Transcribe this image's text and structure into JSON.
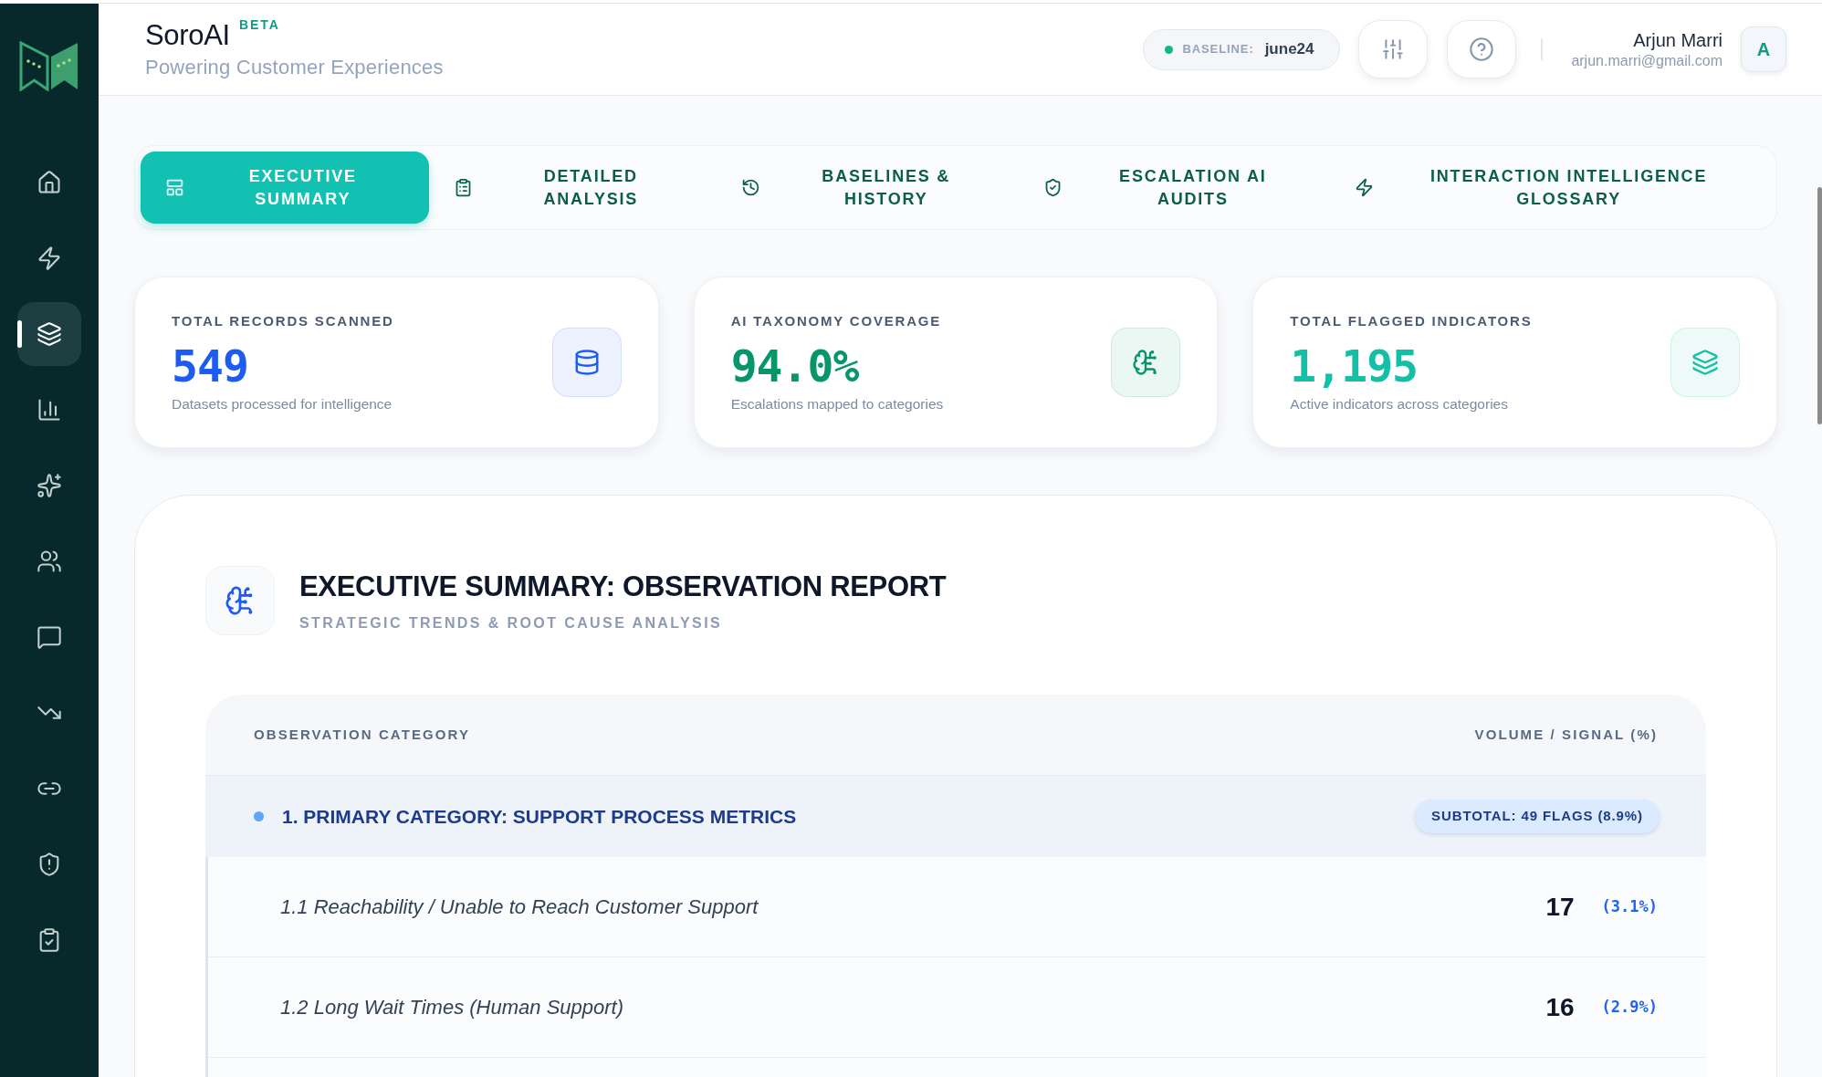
{
  "sidebar": {
    "items": [
      {
        "selected": false
      },
      {
        "selected": false
      },
      {
        "selected": true
      },
      {
        "selected": false
      },
      {
        "selected": false
      },
      {
        "selected": false
      },
      {
        "selected": false
      },
      {
        "selected": false
      },
      {
        "selected": false
      },
      {
        "selected": false
      },
      {
        "selected": false
      }
    ]
  },
  "header": {
    "brand": "SoroAI",
    "badge": "BETA",
    "tagline": "Powering Customer Experiences",
    "baseline": {
      "label": "BASELINE:",
      "value": "june24"
    },
    "user": {
      "name": "Arjun Marri",
      "email": "arjun.marri@gmail.com",
      "initial": "A"
    }
  },
  "tabs": [
    {
      "label": "EXECUTIVE SUMMARY",
      "selected": true
    },
    {
      "label": "DETAILED ANALYSIS",
      "selected": false
    },
    {
      "label": "BASELINES & HISTORY",
      "selected": false
    },
    {
      "label": "ESCALATION AI AUDITS",
      "selected": false
    },
    {
      "label": "INTERACTION INTELLIGENCE GLOSSARY",
      "selected": false
    }
  ],
  "stats": [
    {
      "label": "TOTAL RECORDS SCANNED",
      "value": "549",
      "caption": "Datasets processed for intelligence",
      "color": "#1d5cf2"
    },
    {
      "label": "AI TAXONOMY COVERAGE",
      "value": "94.0%",
      "caption": "Escalations mapped to categories",
      "color": "#059669"
    },
    {
      "label": "TOTAL FLAGGED INDICATORS",
      "value": "1,195",
      "caption": "Active indicators across categories",
      "color": "#14bfa6"
    }
  ],
  "report": {
    "title": "EXECUTIVE SUMMARY: OBSERVATION REPORT",
    "subtitle": "STRATEGIC TRENDS & ROOT CAUSE ANALYSIS",
    "table": {
      "columns": [
        "OBSERVATION CATEGORY",
        "VOLUME / SIGNAL (%)"
      ],
      "groups": [
        {
          "title": "1. PRIMARY CATEGORY: SUPPORT PROCESS METRICS",
          "subtotal": "SUBTOTAL: 49 FLAGS (8.9%)",
          "rows": [
            {
              "name": "1.1 Reachability / Unable to Reach Customer Support",
              "count": "17",
              "share": "(3.1%)"
            },
            {
              "name": "1.2 Long Wait Times (Human Support)",
              "count": "16",
              "share": "(2.9%)"
            }
          ]
        }
      ]
    }
  }
}
